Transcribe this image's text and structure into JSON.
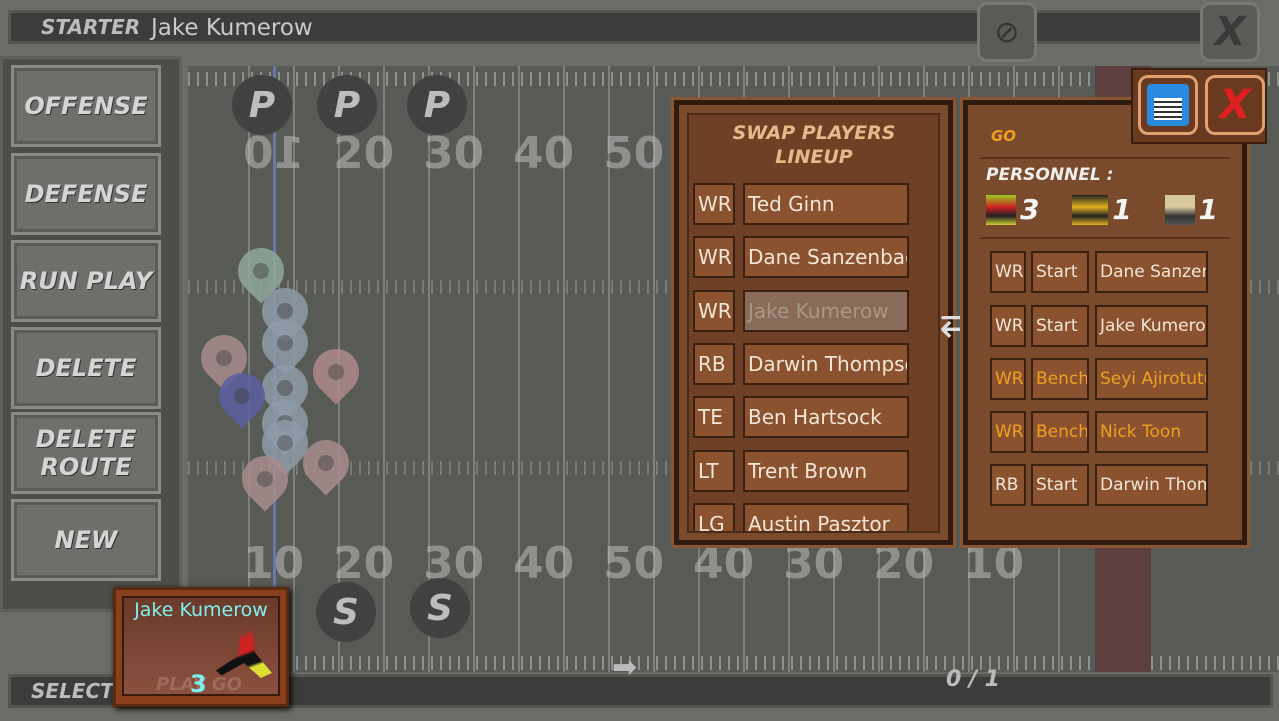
{
  "header": {
    "label": "STARTER",
    "player": "Jake Kumerow"
  },
  "menu": {
    "items": [
      "OFFENSE",
      "DEFENSE",
      "RUN PLAY",
      "DELETE",
      "DELETE ROUTE",
      "NEW"
    ]
  },
  "field": {
    "top_numbers": [
      "10",
      "20",
      "30",
      "40",
      "50"
    ],
    "bottom_numbers": [
      "10",
      "20",
      "30",
      "40",
      "50",
      "40",
      "30",
      "20",
      "10"
    ],
    "top_markers": [
      "P",
      "P",
      "P"
    ],
    "bottom_markers": [
      "S",
      "S"
    ]
  },
  "swap_panel": {
    "title1": "SWAP PLAYERS",
    "title2": "LINEUP",
    "rows": [
      {
        "pos": "WR",
        "name": "Ted Ginn"
      },
      {
        "pos": "WR",
        "name": "Dane Sanzenbach"
      },
      {
        "pos": "WR",
        "name": "Jake Kumerow"
      },
      {
        "pos": "RB",
        "name": "Darwin Thompson"
      },
      {
        "pos": "TE",
        "name": "Ben Hartsock"
      },
      {
        "pos": "LT",
        "name": "Trent Brown"
      },
      {
        "pos": "LG",
        "name": "Austin Pasztor"
      }
    ]
  },
  "go_panel": {
    "title": "GO",
    "personnel_label": "PERSONNEL :",
    "personnel": [
      {
        "icon": "wr-player-icon",
        "count": "3"
      },
      {
        "icon": "rb-player-icon",
        "count": "1"
      },
      {
        "icon": "te-player-icon",
        "count": "1"
      }
    ],
    "rows": [
      {
        "pos": "WR",
        "status": "Start",
        "name": "Dane Sanzenbach"
      },
      {
        "pos": "WR",
        "status": "Start",
        "name": "Jake Kumerow"
      },
      {
        "pos": "WR",
        "status": "Bench",
        "name": "Seyi Ajirotutu"
      },
      {
        "pos": "WR",
        "status": "Bench",
        "name": "Nick Toon"
      },
      {
        "pos": "RB",
        "status": "Start",
        "name": "Darwin Thompson"
      }
    ]
  },
  "selected_card": {
    "name": "Jake Kumerow",
    "number": "3",
    "bg_text": "PLAY GO"
  },
  "bottom": {
    "label": "SELECTED",
    "page": "0 / 1"
  },
  "colors": {
    "accent_orange": "#f0a020",
    "card_name": "#7ff0f0",
    "save_blue": "#2a8ae0",
    "close_red": "#e02020"
  }
}
